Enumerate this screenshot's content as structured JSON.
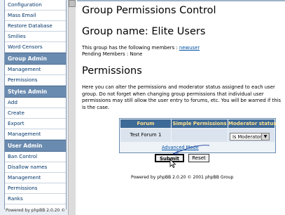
{
  "sidebar": {
    "items": [
      {
        "type": "item",
        "label": "Configuration"
      },
      {
        "type": "item",
        "label": "Mass Email"
      },
      {
        "type": "item",
        "label": "Restore Database"
      },
      {
        "type": "item",
        "label": "Smilies"
      },
      {
        "type": "item",
        "label": "Word Censors"
      },
      {
        "type": "group",
        "label": "Group Admin"
      },
      {
        "type": "item",
        "label": "Management"
      },
      {
        "type": "item",
        "label": "Permissions"
      },
      {
        "type": "group",
        "label": "Styles Admin"
      },
      {
        "type": "item",
        "label": "Add"
      },
      {
        "type": "item",
        "label": "Create"
      },
      {
        "type": "item",
        "label": "Export"
      },
      {
        "type": "item",
        "label": "Management"
      },
      {
        "type": "group",
        "label": "User Admin"
      },
      {
        "type": "item",
        "label": "Ban Control"
      },
      {
        "type": "item",
        "label": "Disallow names"
      },
      {
        "type": "item",
        "label": "Management"
      },
      {
        "type": "item",
        "label": "Permissions"
      },
      {
        "type": "item",
        "label": "Ranks"
      }
    ],
    "powered": "Powered by phpBB 2.0.20 ©"
  },
  "main": {
    "title": "Group Permissions Control",
    "group_heading": "Group name: Elite Users",
    "members_prefix": "This group has the following members : ",
    "member_name": "newuser",
    "pending": "Pending Members : None",
    "permissions_heading": "Permissions",
    "description": "Here you can alter the permissions and moderator status assigned to each user group. Do not forget when changing group permissions that individual user permissions may still allow the user entry to forums, etc. You will be warned if this is the case."
  },
  "table": {
    "headers": [
      "Forum",
      "Simple Permissions",
      "Moderator status"
    ],
    "rows": [
      {
        "forum": "Test Forum 1",
        "simple": "",
        "moderator": "Is Moderator"
      }
    ],
    "advanced_link": "Advanced Mode",
    "submit": "Submit",
    "reset": "Reset"
  },
  "footer": "Powered by phpBB 2.0.20 © 2001 phpBB Group",
  "colors": {
    "header_bg": "#3e6a97",
    "header_text": "#ffe08a",
    "group_bg": "#6a8bb0",
    "link": "#0050a0"
  }
}
